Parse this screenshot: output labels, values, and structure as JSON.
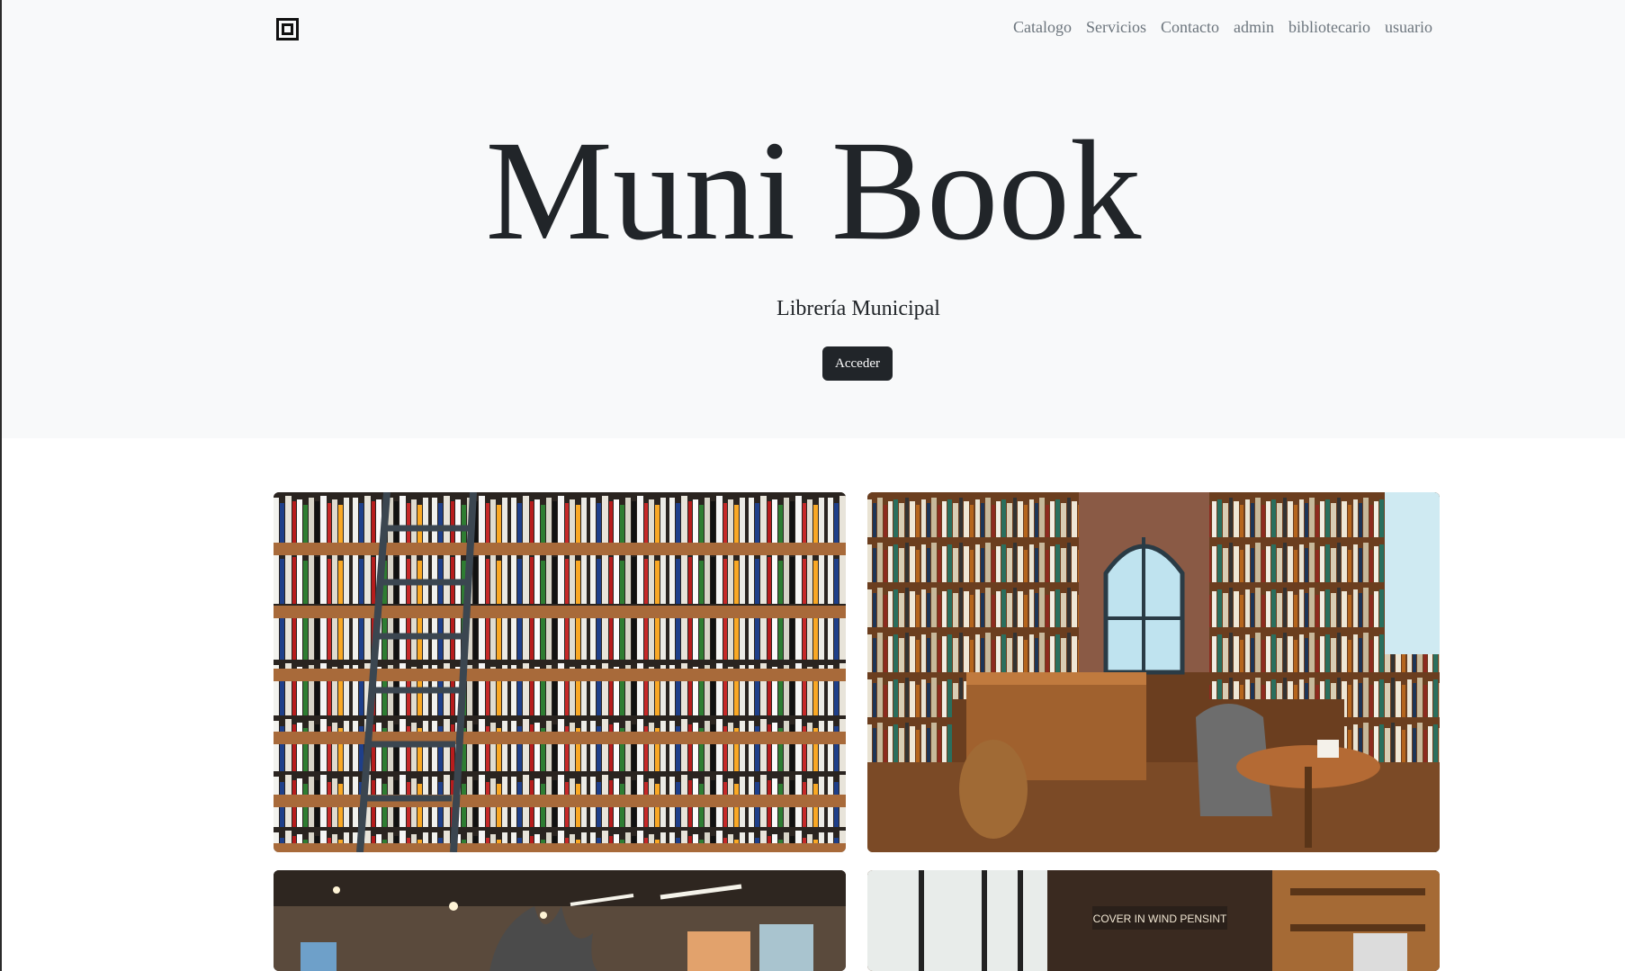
{
  "header": {
    "logo_icon": "square-target-icon",
    "nav": [
      "Catalogo",
      "Servicios",
      "Contacto",
      "admin",
      "bibliotecario",
      "usuario"
    ]
  },
  "hero": {
    "title": "Muni Book",
    "subtitle": "Librería Municipal",
    "cta_label": "Acceder"
  },
  "gallery": {
    "images": [
      {
        "alt": "bookshelves-with-ladder"
      },
      {
        "alt": "cozy-bookstore-cafe"
      },
      {
        "alt": "modern-bookstore-interior"
      },
      {
        "alt": "bookstore-with-windows"
      }
    ],
    "sign_text": "COVER IN WIND PENSINT"
  },
  "colors": {
    "hero_bg": "#f8f9fa",
    "text_dark": "#212529",
    "nav_link": "#6c757d",
    "button_bg": "#212529"
  }
}
